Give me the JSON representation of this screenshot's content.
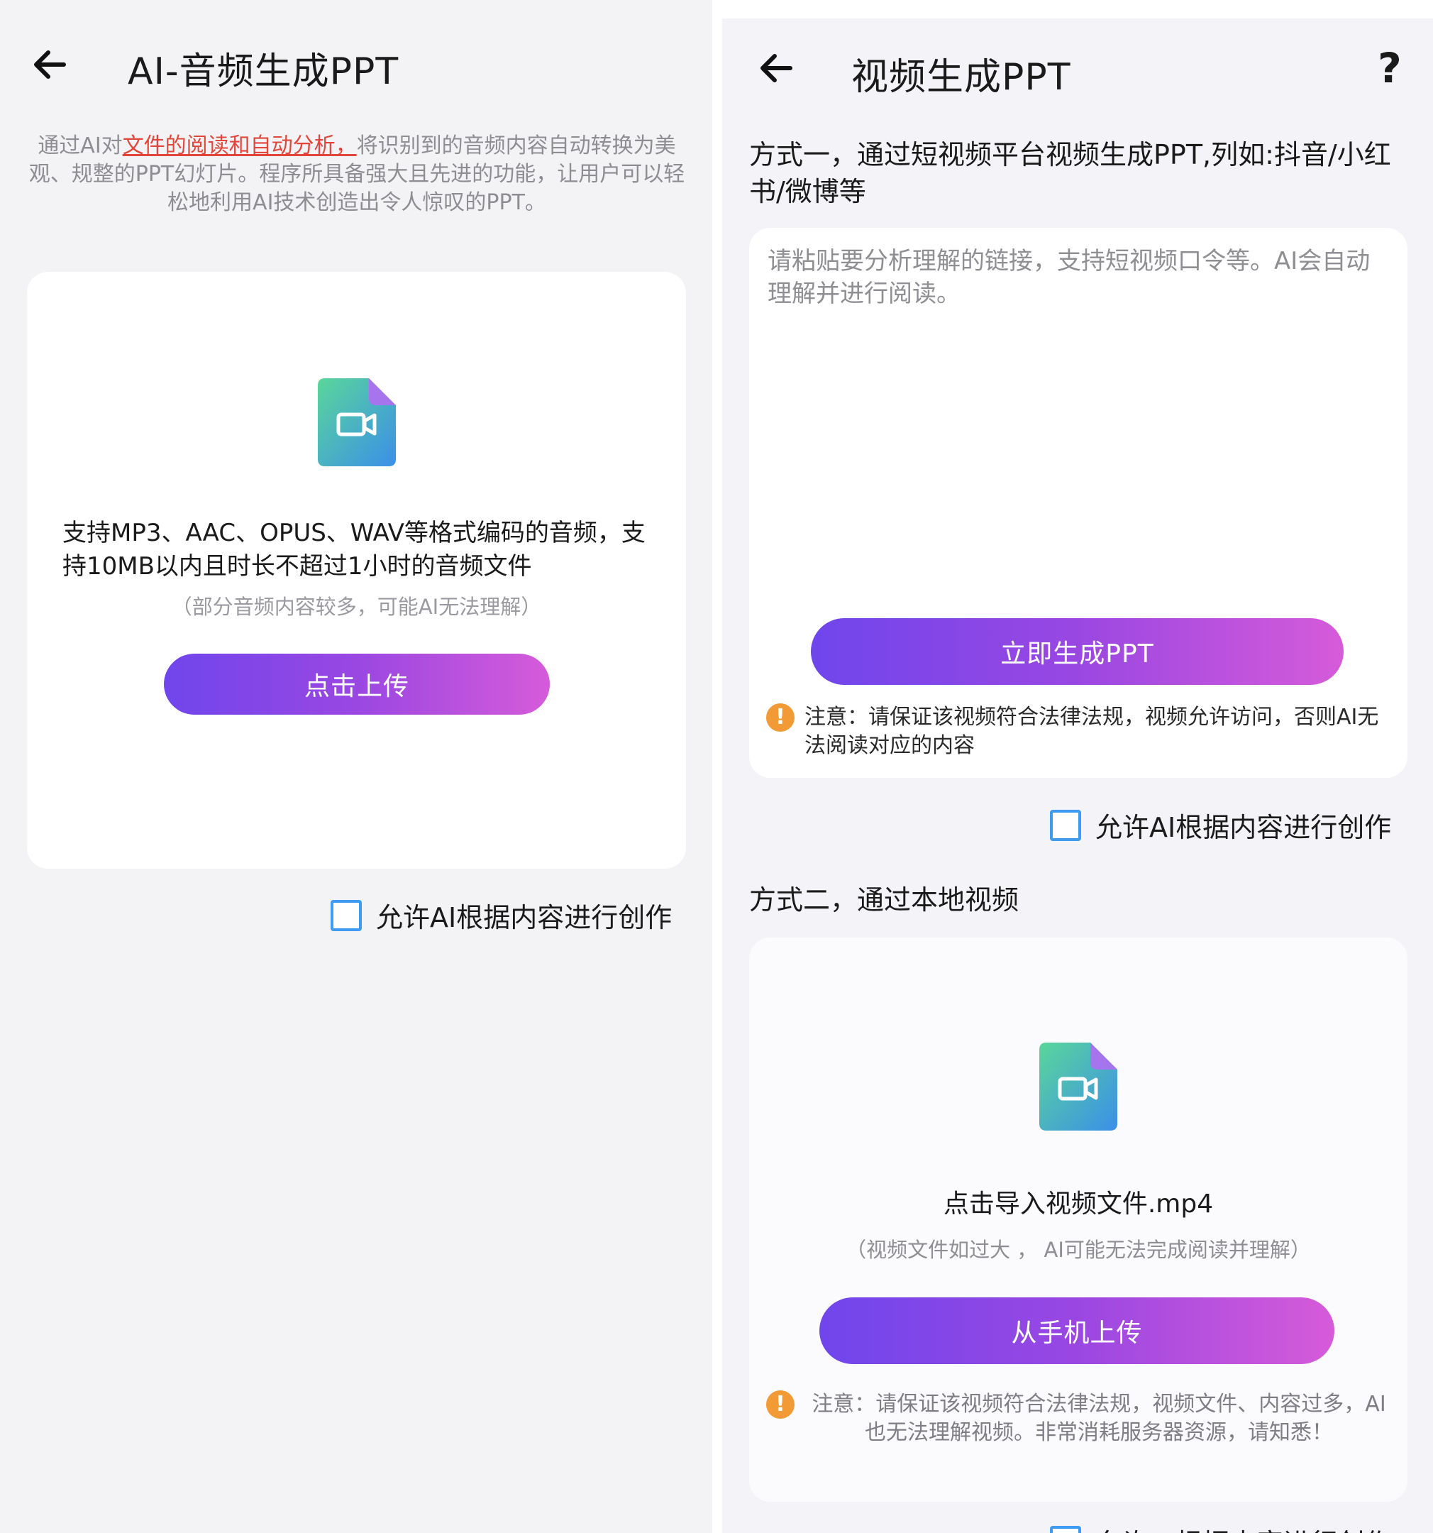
{
  "left": {
    "title": "AI-音频生成PPT",
    "desc_prefix": "通过AI对",
    "desc_highlight": "文件的阅读和自动分析，",
    "desc_suffix": "将识别到的音频内容自动转换为美观、规整的PPT幻灯片。程序所具备强大且先进的功能，让用户可以轻松地利用AI技术创造出令人惊叹的PPT。",
    "support_text": "支持MP3、AAC、OPUS、WAV等格式编码的音频，支持10MB以内且时长不超过1小时的音频文件",
    "support_note": "（部分音频内容较多，可能AI无法理解）",
    "upload_button": "点击上传",
    "allow_label": "允许AI根据内容进行创作"
  },
  "right": {
    "title": "视频生成PPT",
    "help_label": "?",
    "method1_heading": "方式一，通过短视频平台视频生成PPT,列如:抖音/小红书/微博等",
    "link_placeholder": "请粘贴要分析理解的链接，支持短视频口令等。AI会自动理解并进行阅读。",
    "generate_button": "立即生成PPT",
    "warning1": "注意：请保证该视频符合法律法规，视频允许访问，否则AI无法阅读对应的内容",
    "allow_label": "允许AI根据内容进行创作",
    "method2_heading": "方式二，通过本地视频",
    "import_text": "点击导入视频文件.mp4",
    "import_note": "（视频文件如过大 ， AI可能无法完成阅读并理解）",
    "upload_button": "从手机上传",
    "warning2": "注意：请保证该视频符合法律法规，视频文件、内容过多，AI也无法理解视频。非常消耗服务器资源，请知悉！",
    "allow_label_2": "允许AI根据内容进行创作"
  },
  "colors": {
    "accent_gradient_start": "#6f46ec",
    "accent_gradient_end": "#d65bd9",
    "checkbox_blue": "#3f9bf2",
    "warning_orange": "#f29a35",
    "highlight_red": "#e2463a"
  },
  "icons": [
    "back-arrow-icon",
    "video-file-icon",
    "help-icon",
    "warning-icon",
    "checkbox-icon"
  ]
}
